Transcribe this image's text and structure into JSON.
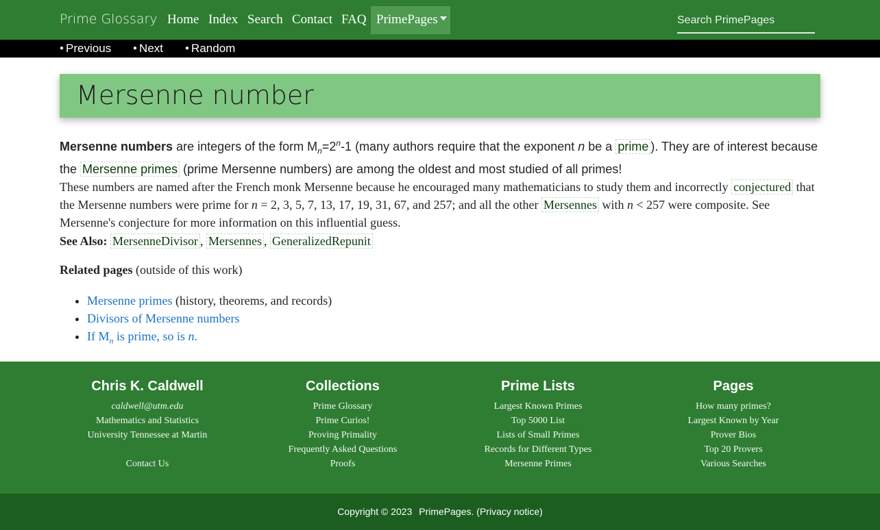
{
  "header": {
    "brand": "Prime Glossary",
    "nav": [
      "Home",
      "Index",
      "Search",
      "Contact",
      "FAQ"
    ],
    "primepages": "PrimePages",
    "search_placeholder": "Search PrimePages"
  },
  "subnav": [
    "Previous",
    "Next",
    "Random"
  ],
  "page": {
    "title": "Mersenne number"
  },
  "content": {
    "p1": {
      "bold": "Mersenne numbers",
      "t1": " are integers of the form M",
      "sub_n": "n",
      "t2": "=2",
      "sup_n": "n",
      "t3": "-1 (many authors require that the exponent ",
      "italic_n": "n",
      "t4": " be a ",
      "link_prime": "prime",
      "t5": "). They are of interest because the ",
      "link_mersenne_primes": "Mersenne primes",
      "t6": " (prime Mersenne numbers) are among the oldest and most studied of all primes!"
    },
    "p2": {
      "t1": "These numbers are named after the French monk Mersenne because he encouraged many mathematicians to study them and incorrectly ",
      "link_conjectured": "conjectured",
      "t2": " that the Mersenne numbers were prime for ",
      "italic_n": "n",
      "t3": " = 2, 3, 5, 7, 13, 17, 19, 31, 67, and 257; and all the other ",
      "link_mersennes": "Mersennes",
      "t4": " with ",
      "italic_n2": "n",
      "t5": " < 257 were composite. See Mersenne's conjecture for more information on this influential guess."
    },
    "see_also": {
      "label": "See Also:",
      "links": [
        "MersenneDivisor",
        "Mersennes",
        "GeneralizedRepunit"
      ]
    },
    "related": {
      "bold": "Related pages",
      "rest": " (outside of this work)",
      "item1_link": "Mersenne primes",
      "item1_rest": " (history, theorems, and records)",
      "item2_link": "Divisors of Mersenne numbers",
      "item3_a": "If M",
      "item3_sub": "n",
      "item3_b": " is prime, so is ",
      "item3_n": "n",
      "item3_c": "."
    }
  },
  "footer": {
    "columns": [
      {
        "title": "Chris K. Caldwell",
        "items": [
          "caldwell@utm.edu",
          "Mathematics and Statistics",
          "University Tennessee at Martin",
          "",
          "Contact Us"
        ]
      },
      {
        "title": "Collections",
        "items": [
          "Prime Glossary",
          "Prime Curios!",
          "Proving Primality",
          "Frequently Asked Questions",
          "Proofs"
        ]
      },
      {
        "title": "Prime Lists",
        "items": [
          "Largest Known Primes",
          "Top 5000 List",
          "Lists of Small Primes",
          "Records for Different Types",
          "Mersenne Primes"
        ]
      },
      {
        "title": "Pages",
        "items": [
          "How many primes?",
          "Largest Known by Year",
          "Prover Bios",
          "Top 20 Provers",
          "Various Searches"
        ]
      }
    ],
    "copyright": "Copyright © 2023",
    "site": "PrimePages",
    "privacy_open": ". (",
    "privacy": "Privacy notice",
    "privacy_close": ")"
  },
  "colors": {
    "nav_green": "#2e7d32",
    "banner_green": "#81c784",
    "subfooter_green": "#1b5e20",
    "link_blue": "#1a73c8"
  }
}
